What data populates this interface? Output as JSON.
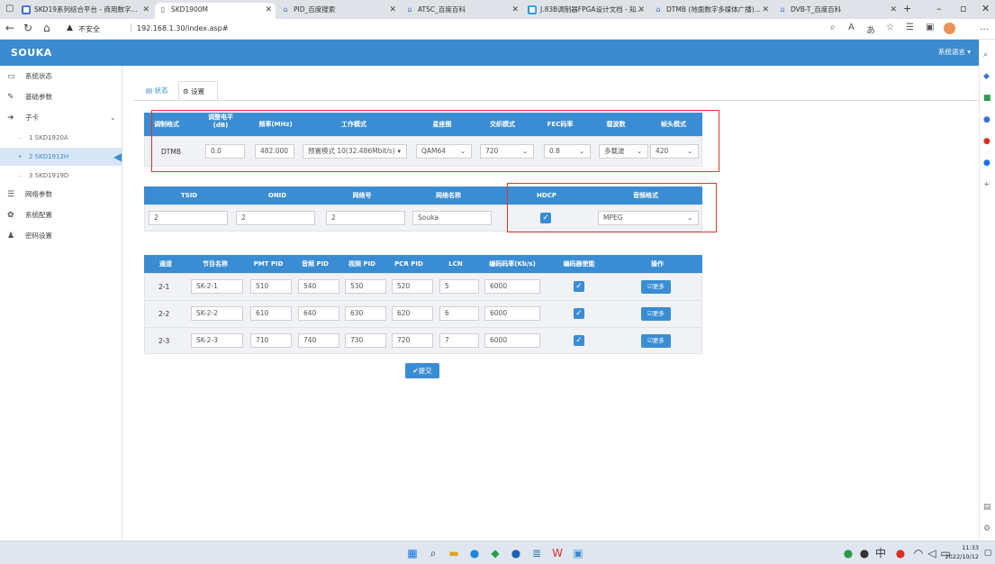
{
  "browser": {
    "tabs": [
      {
        "label": "SKD19系列综合平台 - 商用数字...",
        "active": false
      },
      {
        "label": "SKD1900M",
        "active": true
      },
      {
        "label": "PID_百度搜索",
        "active": false
      },
      {
        "label": "ATSC_百度百科",
        "active": false
      },
      {
        "label": "J.83B调制器FPGA设计文档 - 知...",
        "active": false
      },
      {
        "label": "DTMB (地面数字多媒体广播)...",
        "active": false
      },
      {
        "label": "DVB-T_百度百科",
        "active": false
      }
    ],
    "security_warning": "不安全",
    "url": "192.168.1.30/index.asp#"
  },
  "app": {
    "brand": "SOUKA",
    "language_button": "系统语言 ▾"
  },
  "sidebar": {
    "items": [
      {
        "label": "系统状态",
        "icon": "monitor-icon"
      },
      {
        "label": "基础参数",
        "icon": "wrench-icon"
      },
      {
        "label": "子卡",
        "icon": "card-icon"
      },
      {
        "label": "网络参数",
        "icon": "list-icon"
      },
      {
        "label": "系统配置",
        "icon": "gear-icon"
      },
      {
        "label": "密码设置",
        "icon": "user-icon"
      }
    ],
    "subcards": [
      {
        "label": "1  SKD1920A",
        "active": false
      },
      {
        "label": "2  SKD1912H",
        "active": true
      },
      {
        "label": "3  SKD1919D",
        "active": false
      }
    ]
  },
  "content_tabs": [
    {
      "label": "状态",
      "icon": "status-icon"
    },
    {
      "label": "设置",
      "icon": "settings-icon"
    }
  ],
  "modulation_table": {
    "headers": [
      "调制格式",
      "调整电平\n(dB)",
      "频率(MHz)",
      "工作模式",
      "星座图",
      "交织模式",
      "FEC码率",
      "载波数",
      "帧头模式"
    ],
    "row": {
      "format": "DTMB",
      "level": "0.0",
      "frequency": "482.000",
      "work_mode": "预置模式 10(32.486Mbit/s)",
      "constellation": "QAM64",
      "interleave": "720",
      "fec": "0.8",
      "carrier": "多载波",
      "frame_header": "420"
    }
  },
  "network_table": {
    "headers": [
      "TSID",
      "ONID",
      "网络号",
      "网络名称",
      "HDCP",
      "音频格式"
    ],
    "row": {
      "tsid": "2",
      "onid": "2",
      "network_id": "2",
      "network_name": "Souka",
      "hdcp": true,
      "audio_format": "MPEG"
    }
  },
  "program_table": {
    "headers": [
      "通道",
      "节目名称",
      "PMT PID",
      "音频 PID",
      "视频 PID",
      "PCR PID",
      "LCN",
      "编码码率(Kb/s)",
      "编码器使能",
      "操作"
    ],
    "more_label": "更多",
    "rows": [
      {
        "channel": "2-1",
        "name": "SK-2-1",
        "pmt": "510",
        "audio": "540",
        "video": "530",
        "pcr": "520",
        "lcn": "5",
        "bitrate": "6000",
        "enabled": true
      },
      {
        "channel": "2-2",
        "name": "SK-2-2",
        "pmt": "610",
        "audio": "640",
        "video": "630",
        "pcr": "620",
        "lcn": "6",
        "bitrate": "6000",
        "enabled": true
      },
      {
        "channel": "2-3",
        "name": "SK-2-3",
        "pmt": "710",
        "audio": "740",
        "video": "730",
        "pcr": "720",
        "lcn": "7",
        "bitrate": "6000",
        "enabled": true
      }
    ]
  },
  "submit_label": "提交",
  "taskbar": {
    "time": "11:33",
    "date": "2022/10/12"
  }
}
